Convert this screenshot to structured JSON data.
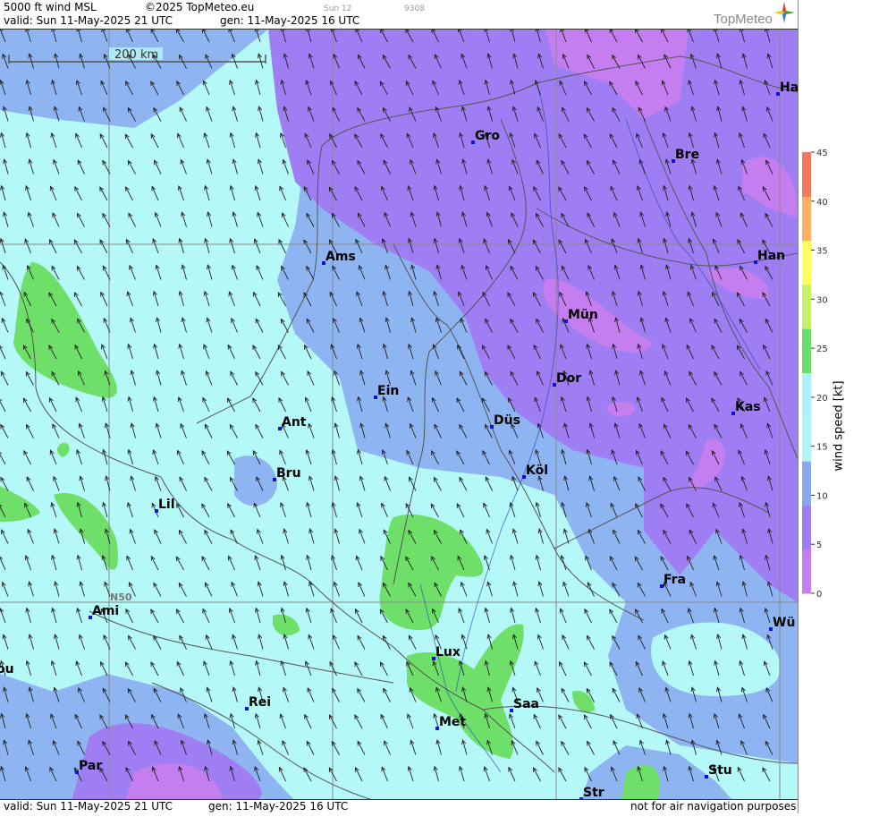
{
  "header": {
    "title": "5000 ft wind MSL",
    "copyright": "©2025 TopMeteo.eu",
    "day_tab": "Sun 12",
    "code": "9308",
    "valid": "valid:  Sun  11-May-2025  21 UTC",
    "generated": "gen: 11-May-2025 16 UTC",
    "logo_text": "TopMeteo"
  },
  "footer": {
    "valid": "valid:  Sun  11-May-2025  21 UTC",
    "generated": "gen: 11-May-2025 16 UTC",
    "disclaimer": "not for air navigation purposes"
  },
  "map": {
    "scale_label": "200 km",
    "latitude_label": "N50",
    "cities": [
      {
        "name": "Ha"
      },
      {
        "name": "Gro"
      },
      {
        "name": "Bre"
      },
      {
        "name": "Ams"
      },
      {
        "name": "Han"
      },
      {
        "name": "Mün"
      },
      {
        "name": "Ein"
      },
      {
        "name": "Dor"
      },
      {
        "name": "Kas"
      },
      {
        "name": "Ant"
      },
      {
        "name": "Düs"
      },
      {
        "name": "Bru"
      },
      {
        "name": "Köl"
      },
      {
        "name": "Lil"
      },
      {
        "name": "Fra"
      },
      {
        "name": "Ami"
      },
      {
        "name": "Wü"
      },
      {
        "name": "Lux"
      },
      {
        "name": "ou"
      },
      {
        "name": "Rei"
      },
      {
        "name": "Saa"
      },
      {
        "name": "Met"
      },
      {
        "name": "Par"
      },
      {
        "name": "Stu"
      },
      {
        "name": "Str"
      }
    ],
    "wind_direction": "from south-east (arrows pointing north-west)"
  },
  "legend": {
    "title": "wind speed  [kt]",
    "ticks": [
      "45",
      "40",
      "35",
      "30",
      "25",
      "20",
      "15",
      "10",
      "5",
      "0"
    ],
    "colors": [
      "#c47ef0",
      "#9f7ef4",
      "#8aa6f0",
      "#b5f5fa",
      "#b0f0ff",
      "#66e06a",
      "#c8f068",
      "#ffff60",
      "#ffb060",
      "#f07a60"
    ]
  },
  "colors": {
    "lilac": "#c47ef0",
    "purple": "#9f7ef4",
    "blue": "#8fb4f2",
    "cyan": "#b4f8f8",
    "green": "#6ee06a",
    "city_marker": "#1010e0"
  }
}
